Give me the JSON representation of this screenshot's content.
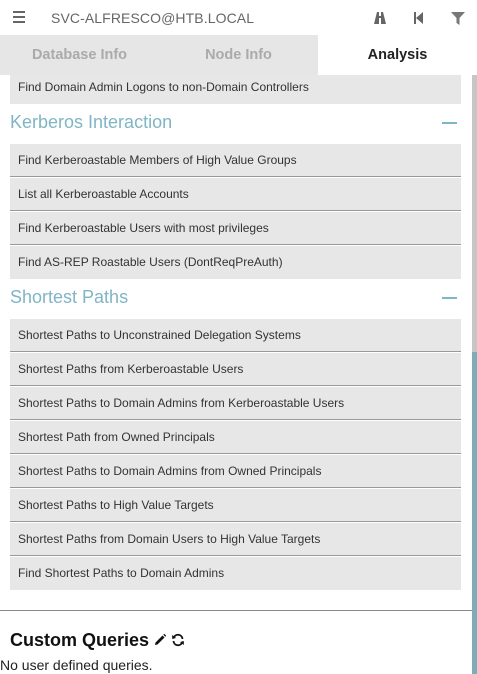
{
  "header": {
    "title": "SVC-ALFRESCO@HTB.LOCAL",
    "icons": [
      "menu-icon",
      "pathfinding-icon",
      "back-icon",
      "filter-icon"
    ]
  },
  "tabs": [
    {
      "label": "Database Info",
      "active": false
    },
    {
      "label": "Node Info",
      "active": false
    },
    {
      "label": "Analysis",
      "active": true
    }
  ],
  "prev_section": {
    "items": [
      "Find Domain Admin Logons to non-Domain Controllers"
    ]
  },
  "kerberos": {
    "title": "Kerberos Interaction",
    "items": [
      "Find Kerberoastable Members of High Value Groups",
      "List all Kerberoastable Accounts",
      "Find Kerberoastable Users with most privileges",
      "Find AS-REP Roastable Users (DontReqPreAuth)"
    ]
  },
  "shortest": {
    "title": "Shortest Paths",
    "items": [
      "Shortest Paths to Unconstrained Delegation Systems",
      "Shortest Paths from Kerberoastable Users",
      "Shortest Paths to Domain Admins from Kerberoastable Users",
      "Shortest Path from Owned Principals",
      "Shortest Paths to Domain Admins from Owned Principals",
      "Shortest Paths to High Value Targets",
      "Shortest Paths from Domain Users to High Value Targets",
      "Find Shortest Paths to Domain Admins"
    ]
  },
  "custom": {
    "title": "Custom Queries",
    "empty_text": "No user defined queries."
  },
  "colors": {
    "accent": "#7fb5c5",
    "item_bg": "#e7e7e7",
    "tab_inactive_bg": "#e6e6e6"
  }
}
